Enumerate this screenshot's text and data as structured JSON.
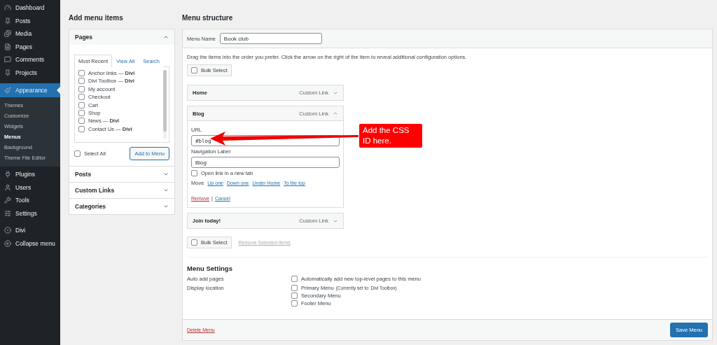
{
  "sidebar": {
    "items": [
      {
        "label": "Dashboard",
        "selected": false
      },
      {
        "label": "Posts",
        "selected": false
      },
      {
        "label": "Media",
        "selected": false
      },
      {
        "label": "Pages",
        "selected": false
      },
      {
        "label": "Comments",
        "selected": false
      },
      {
        "label": "Projects",
        "selected": false
      },
      {
        "label": "Appearance",
        "selected": true,
        "children": [
          {
            "label": "Themes",
            "selected": false
          },
          {
            "label": "Customize",
            "selected": false
          },
          {
            "label": "Widgets",
            "selected": false
          },
          {
            "label": "Menus",
            "selected": true
          },
          {
            "label": "Background",
            "selected": false
          },
          {
            "label": "Theme File Editor",
            "selected": false
          }
        ]
      },
      {
        "label": "Plugins",
        "selected": false
      },
      {
        "label": "Users",
        "selected": false
      },
      {
        "label": "Tools",
        "selected": false
      },
      {
        "label": "Settings",
        "selected": false
      },
      {
        "label": "Divi",
        "selected": false
      },
      {
        "label": "Collapse menu",
        "selected": false
      }
    ]
  },
  "add_items": {
    "title": "Add menu items",
    "sections": [
      {
        "title": "Pages",
        "expanded": true,
        "tabs": [
          {
            "label": "Most Recent",
            "selected": true
          },
          {
            "label": "View All",
            "selected": false
          },
          {
            "label": "Search",
            "selected": false
          }
        ],
        "pages": [
          {
            "label": "Anchor links — **Divi**",
            "checked": false
          },
          {
            "label": "Divi Toolbox — **Divi**",
            "checked": false
          },
          {
            "label": "My account",
            "checked": false
          },
          {
            "label": "Checkout",
            "checked": false
          },
          {
            "label": "Cart",
            "checked": false
          },
          {
            "label": "Shop",
            "checked": false
          },
          {
            "label": "News — **Divi**",
            "checked": false
          },
          {
            "label": "Contact Us — **Divi**",
            "checked": false
          }
        ],
        "select_all": {
          "label": "Select All",
          "checked": false
        },
        "button": "Add to Menu"
      },
      {
        "title": "Posts",
        "expanded": false
      },
      {
        "title": "Custom Links",
        "expanded": false
      },
      {
        "title": "Categories",
        "expanded": false
      }
    ]
  },
  "menu_structure": {
    "title": "Menu structure",
    "menu_name_label": "Menu Name",
    "menu_name": "Book club",
    "instructions": "Drag the items into the order you prefer. Click the arrow on the right of the item to reveal additional configuration options.",
    "bulk_select": {
      "label": "Bulk Select",
      "checked": false
    },
    "items": [
      {
        "title": "Home",
        "type": "Custom Link",
        "expanded": false
      },
      {
        "title": "Blog",
        "type": "Custom Link",
        "expanded": true,
        "url_label": "URL",
        "url": "#blog",
        "nav_label_label": "Navigation Label",
        "nav_label": "Blog",
        "new_tab": {
          "label": "Open link in a new tab",
          "checked": false
        },
        "move_label": "Move",
        "move_links": [
          "Up one",
          "Down one",
          "Under Home",
          "To the top"
        ],
        "remove": "Remove",
        "separator": "|",
        "cancel": "Cancel"
      },
      {
        "title": "Join today!",
        "type": "Custom Link",
        "expanded": false
      }
    ],
    "bulk_select_bottom": {
      "label": "Bulk Select",
      "checked": false
    },
    "remove_selected": "Remove Selected Items",
    "settings": {
      "title": "Menu Settings",
      "rows": [
        {
          "label": "Auto add pages",
          "options": [
            {
              "label": "Automatically add new top-level pages to this menu",
              "checked": false
            }
          ]
        },
        {
          "label": "Display location",
          "options": [
            {
              "label": "Primary Menu",
              "note": "(Currently set to: Divi Toolbox)",
              "checked": false
            },
            {
              "label": "Secondary Menu",
              "checked": false
            },
            {
              "label": "Footer Menu",
              "checked": false
            }
          ]
        }
      ]
    },
    "delete": "Delete Menu",
    "save": "Save Menu"
  },
  "annotation": {
    "text": "Add the CSS ID here."
  }
}
